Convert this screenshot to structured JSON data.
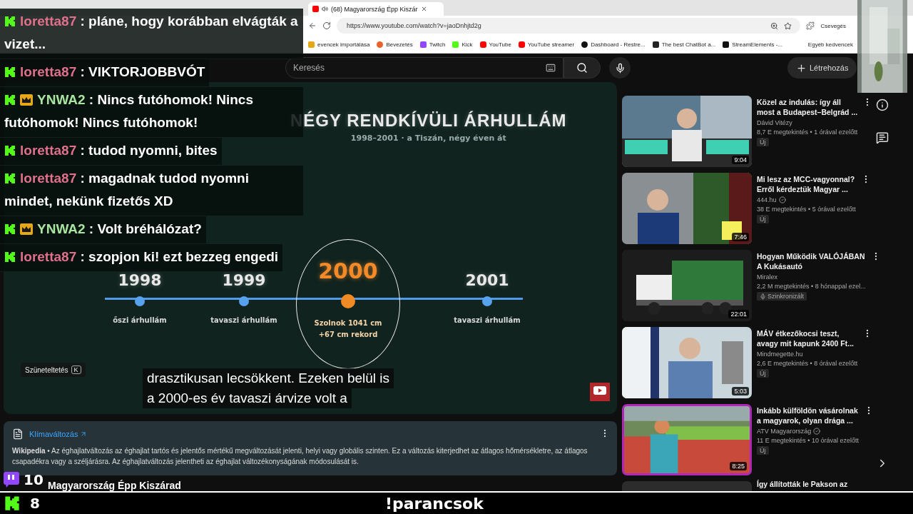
{
  "browser": {
    "tab_title": "(68) Magyarország Épp Kiszár",
    "url": "https://www.youtube.com/watch?v=jaoDnhjtd2g",
    "bookmarks": [
      {
        "label": "evencek importálása",
        "kind": "plain"
      },
      {
        "label": "Bevezetés",
        "kind": "firefox"
      },
      {
        "label": "Twitch",
        "kind": "twitch"
      },
      {
        "label": "Kick",
        "kind": "kick"
      },
      {
        "label": "YouTube",
        "kind": "youtube"
      },
      {
        "label": "YouTube streamer",
        "kind": "youtube"
      },
      {
        "label": "Dashboard - Restre...",
        "kind": "restream"
      },
      {
        "label": "The best ChatBot a...",
        "kind": "chatbot"
      },
      {
        "label": "StreamElements -...",
        "kind": "streamelements"
      }
    ],
    "other_bookmarks": "Egyéb kedvencek",
    "chat_button": "Csevegés"
  },
  "youtube": {
    "search_placeholder": "Keresés",
    "create_label": "Létrehozás"
  },
  "player": {
    "heading": "NÉGY RENDKÍVÜLI ÁRHULLÁM",
    "subheading": "1998–2001 · a Tiszán, négy éven át",
    "timeline": [
      {
        "year": "1998",
        "label": "őszi árhullám",
        "highlighted": false
      },
      {
        "year": "1999",
        "label": "tavaszi árhullám",
        "highlighted": false
      },
      {
        "year": "2000",
        "label": "Szolnok 1041 cm\n+67 cm rekord",
        "highlighted": true
      },
      {
        "year": "2001",
        "label": "tavaszi árhullám",
        "highlighted": false
      }
    ],
    "pause_tooltip": "Szüneteltetés",
    "pause_key": "K",
    "captions": [
      "drasztikusan lecsökkent. Ezeken belül is",
      "a 2000-es év tavaszi árvize volt a"
    ]
  },
  "info_panel": {
    "title": "Klímaváltozás",
    "text": "**Wikipedia** • Az éghajlatváltozás az éghajlat tartós és jelentős mértékű megváltozását jelenti, helyi vagy globális szinten. Ez a változás kiterjedhet az átlagos hőmérsékletre, az átlagos csapadékra vagy a széljárásra. Az éghajlatváltozás jelentheti az éghajlat változékonyságának módosulását is."
  },
  "video_title": "Magyarország Épp Kiszárad",
  "sidebar": {
    "videos": [
      {
        "title": "Közel az indulás: így áll most a Budapest–Belgrád ...",
        "channel": "Dávid Vitézy",
        "verified": false,
        "meta": "8,7 E megtekintés • 1 órával ezelőtt",
        "badge": "Új",
        "dubbed": false,
        "duration": "9:04",
        "selected": false
      },
      {
        "title": "Mi lesz az MCC-vagyonnal? Erről kérdeztük Magyar ...",
        "channel": "444.hu",
        "verified": true,
        "meta": "38 E megtekintés • 5 órával ezelőtt",
        "badge": "Új",
        "dubbed": false,
        "duration": "7:46",
        "selected": false
      },
      {
        "title": "Hogyan Működik VALÓJÁBAN A Kukásautó",
        "channel": "Miralex",
        "verified": false,
        "meta": "2,2 M megtekintés • 8 hónappal ezel...",
        "badge": "Szinkronizált",
        "dubbed": true,
        "duration": "22:01",
        "selected": false
      },
      {
        "title": "MÁV étkezőkocsi teszt, avagy mit kapunk 2400 Ft...",
        "channel": "Mindmegette.hu",
        "verified": false,
        "meta": "2,6 E megtekintés • 8 órával ezelőtt",
        "badge": "Új",
        "dubbed": false,
        "duration": "5:03",
        "selected": false
      },
      {
        "title": "Inkább külföldön vásárolnak a magyarok, olyan drága ...",
        "channel": "ATV Magyarország",
        "verified": true,
        "meta": "11 E megtekintés • 10 órával ezelőtt",
        "badge": "Új",
        "dubbed": false,
        "duration": "8:25",
        "selected": true
      },
      {
        "title": "Így állították le Pakson az",
        "selected": false
      }
    ]
  },
  "chat": {
    "messages": [
      {
        "user": "loretta87",
        "color": "#e0708c",
        "crown": false,
        "text": ": pláne, hogy korábban elvágták a vizet..."
      },
      {
        "user": "loretta87",
        "color": "#e0708c",
        "crown": false,
        "text": ": VIKTORJOBBVÓT"
      },
      {
        "user": "YNWA2",
        "color": "#a8e6a0",
        "crown": true,
        "text": ": Nincs futóhomok! Nincs futóhomok! Nincs futóhomok!"
      },
      {
        "user": "loretta87",
        "color": "#e0708c",
        "crown": false,
        "text": ": tudod nyomni, bites"
      },
      {
        "user": "loretta87",
        "color": "#e0708c",
        "crown": false,
        "text": ": magadnak tudod nyomni mindet, nekünk fizetős XD"
      },
      {
        "user": "YNWA2",
        "color": "#a8e6a0",
        "crown": true,
        "text": ": Volt bréhálózat?"
      },
      {
        "user": "loretta87",
        "color": "#e0708c",
        "crown": false,
        "text": ": szopjon ki! ezt bezzeg engedi"
      }
    ]
  },
  "stream": {
    "twitch_viewers": "10",
    "kick_viewers": "8",
    "command": "!parancsok"
  }
}
